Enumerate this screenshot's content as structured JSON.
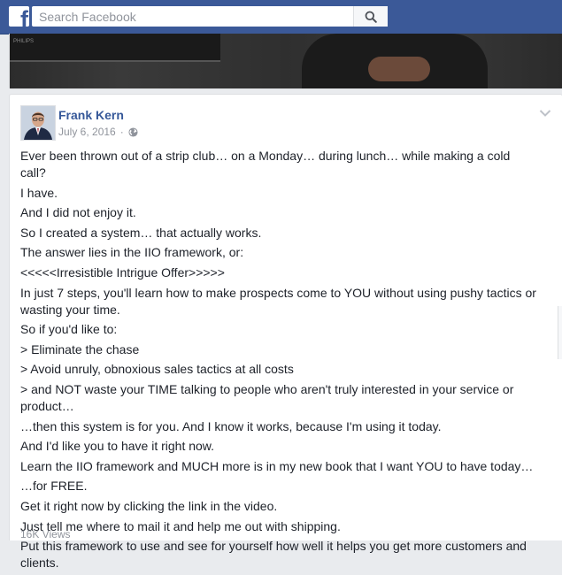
{
  "header": {
    "logo_letter": "f",
    "search_placeholder": "Search Facebook"
  },
  "video": {
    "monitor_brand": "PHILIPS"
  },
  "post": {
    "author": "Frank Kern",
    "date": "July 6, 2016",
    "privacy_icon": "globe-icon",
    "paragraphs": [
      "Ever been thrown out of a strip club… on a Monday… during lunch… while making a cold call?",
      "I have.",
      "And I did not enjoy it.",
      "So I created a system… that actually works.",
      "The answer lies in the IIO framework, or:",
      "<<<<<Irresistible Intrigue Offer>>>>>",
      "In just 7 steps, you'll learn how to make prospects come to YOU without using pushy tactics or wasting your time.",
      "So if you'd like to:",
      "> Eliminate the chase",
      "> Avoid unruly, obnoxious sales tactics at all costs",
      "> and NOT waste your TIME talking to people who aren't truly interested in your service or product…",
      "…then this system is for you. And I know it works, because I'm using it today.",
      "And I'd like you to have it right now.",
      "Learn the IIO framework and MUCH more is in my new book that I want YOU to have today…",
      "…for FREE.",
      "Get it right now by clicking the link in the video.",
      "Just tell me where to mail it and help me out with shipping.",
      "Put this framework to use and see for yourself how well it helps you get more customers and clients."
    ],
    "views": "16K Views"
  },
  "colors": {
    "brand_blue": "#3b5998",
    "link_blue": "#365899",
    "page_bg": "#e9ebee",
    "meta_gray": "#90949c"
  }
}
